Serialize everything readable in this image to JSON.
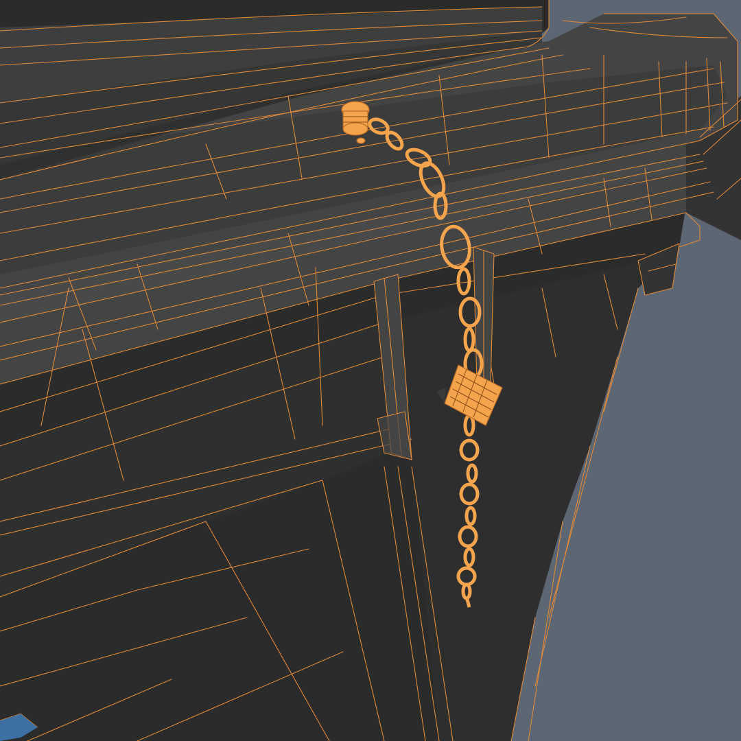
{
  "scene": {
    "subject": "",
    "colors": {
      "background": "#5d6673",
      "mesh_dark": "#2b2b2b",
      "mesh_mid": "#333333",
      "mesh_light": "#444444",
      "wireframe": "#e08a3a",
      "hardware": "#f3a44c"
    }
  }
}
